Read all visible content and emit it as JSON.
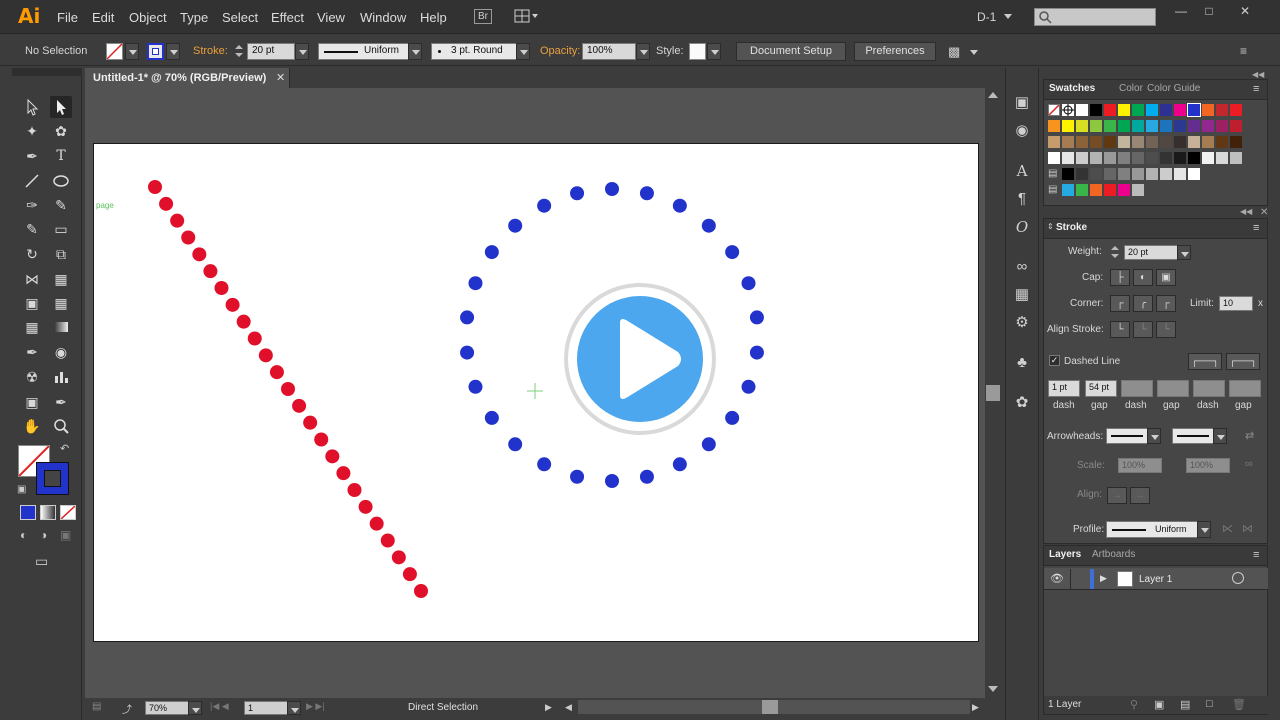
{
  "app": {
    "logo": "Ai",
    "menu": [
      "File",
      "Edit",
      "Object",
      "Type",
      "Select",
      "Effect",
      "View",
      "Window",
      "Help"
    ],
    "bridge_label": "Br",
    "workspace_label": "D-1"
  },
  "control": {
    "selection_label": "No Selection",
    "stroke_label": "Stroke:",
    "stroke_weight": "20 pt",
    "stroke_profile": "Uniform",
    "brush": "3 pt. Round",
    "opacity_label": "Opacity:",
    "opacity_value": "100%",
    "style_label": "Style:",
    "document_setup": "Document Setup",
    "preferences": "Preferences"
  },
  "document": {
    "tab_title": "Untitled-1* @ 70% (RGB/Preview)",
    "artboard_label": "page",
    "zoom": "70%",
    "artboard_number": "1",
    "tool_status": "Direct Selection"
  },
  "swatches_panel": {
    "tabs": [
      "Swatches",
      "Color",
      "Color Guide"
    ]
  },
  "stroke_panel": {
    "title": "Stroke",
    "weight_label": "Weight:",
    "weight_value": "20 pt",
    "cap_label": "Cap:",
    "corner_label": "Corner:",
    "limit_label": "Limit:",
    "limit_value": "10",
    "limit_unit": "x",
    "align_label": "Align Stroke:",
    "dashed_label": "Dashed Line",
    "dash_values": [
      "1 pt",
      "54 pt",
      "",
      "",
      "",
      ""
    ],
    "dash_labels": [
      "dash",
      "gap",
      "dash",
      "gap",
      "dash",
      "gap"
    ],
    "arrowheads_label": "Arrowheads:",
    "scale_label": "Scale:",
    "scale_values": [
      "100%",
      "100%"
    ],
    "align_arrow_label": "Align:",
    "profile_label": "Profile:",
    "profile_value": "Uniform"
  },
  "layers_panel": {
    "tabs": [
      "Layers",
      "Artboards"
    ],
    "layer_name": "Layer 1",
    "layer_count": "1 Layer"
  },
  "colors": {
    "red_dot": "#e0102a",
    "blue_dot": "#2233cc",
    "play_button": "#4da7ee"
  },
  "icons": {
    "play": "play-icon"
  }
}
